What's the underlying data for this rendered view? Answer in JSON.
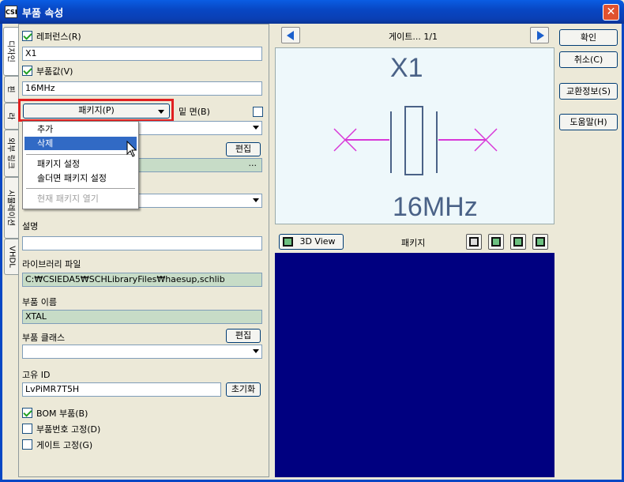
{
  "window": {
    "title": "부품 속성",
    "icon_text": "CSI"
  },
  "tabs": [
    {
      "label": "디자인",
      "active": true
    },
    {
      "label": "핀"
    },
    {
      "label": "라"
    },
    {
      "label": "외부 링크"
    },
    {
      "label": "시뮬레이션"
    },
    {
      "label": "VHDL"
    }
  ],
  "form": {
    "reference_label": "레퍼런스(R)",
    "reference_value": "X1",
    "value_label": "부품값(V)",
    "value_value": "16MHz",
    "package_button": "패키지(P)",
    "solder_side_label": "밑 면(B)",
    "edit_button": "편집",
    "edit_ellipsis": "...",
    "description_label": "설명",
    "description_value": "",
    "library_label": "라이브러리 파일",
    "library_value": "C:₩CSIEDA5₩SCHLibraryFiles₩haesup,schlib",
    "part_name_label": "부품 이름",
    "part_name_value": "XTAL",
    "part_class_label": "부품 클래스",
    "part_class_edit": "편집",
    "unique_id_label": "고유 ID",
    "unique_id_value": "LvPiMR7T5H",
    "reset_button": "초기화",
    "bom_label": "BOM 부품(B)",
    "fix_number_label": "부품번호 고정(D)",
    "fix_gate_label": "게이트 고정(G)"
  },
  "menu": {
    "items": [
      {
        "label": "추가"
      },
      {
        "label": "삭제",
        "highlighted": true
      },
      {
        "label": "패키지 설정"
      },
      {
        "label": "솔더면 패키지 설정"
      },
      {
        "label": "현재 패키지 열기",
        "disabled": true
      }
    ]
  },
  "preview": {
    "gate_label": "게이트... 1/1",
    "ref_text": "X1",
    "value_text": "16MHz",
    "view3d_button": "3D View",
    "package_label": "패키지"
  },
  "actions": {
    "ok": "확인",
    "cancel": "취소(C)",
    "exchange": "교환정보(S)",
    "help": "도움말(H)"
  }
}
